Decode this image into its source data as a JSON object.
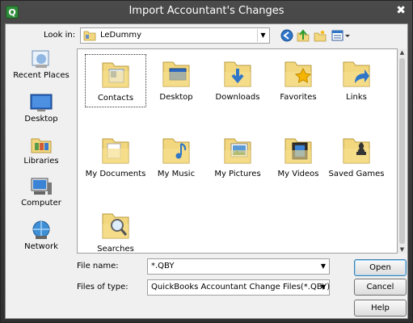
{
  "window": {
    "title": "Import Accountant's Changes",
    "app_icon_glyph": "Q",
    "close_glyph": "✖"
  },
  "lookin": {
    "label": "Look in:",
    "value": "LeDummy"
  },
  "toolbar": {
    "icons": [
      "back-icon",
      "up-folder-icon",
      "new-folder-icon",
      "views-menu-icon"
    ]
  },
  "places": [
    {
      "label": "Recent Places",
      "icon": "recent-places-icon"
    },
    {
      "label": "Desktop",
      "icon": "desktop-icon"
    },
    {
      "label": "Libraries",
      "icon": "libraries-icon"
    },
    {
      "label": "Computer",
      "icon": "computer-icon"
    },
    {
      "label": "Network",
      "icon": "network-icon"
    }
  ],
  "items": [
    {
      "label": "Contacts",
      "icon": "contacts-folder-icon",
      "selected": true
    },
    {
      "label": "Desktop",
      "icon": "desktop-folder-icon"
    },
    {
      "label": "Downloads",
      "icon": "downloads-folder-icon"
    },
    {
      "label": "Favorites",
      "icon": "favorites-folder-icon"
    },
    {
      "label": "Links",
      "icon": "links-folder-icon"
    },
    {
      "label": "My Documents",
      "icon": "documents-folder-icon"
    },
    {
      "label": "My Music",
      "icon": "music-folder-icon"
    },
    {
      "label": "My Pictures",
      "icon": "pictures-folder-icon"
    },
    {
      "label": "My Videos",
      "icon": "videos-folder-icon"
    },
    {
      "label": "Saved Games",
      "icon": "saved-games-folder-icon"
    },
    {
      "label": "Searches",
      "icon": "searches-folder-icon"
    }
  ],
  "filename": {
    "label": "File name:",
    "value": "*.QBY"
  },
  "filetype": {
    "label": "Files of type:",
    "value": "QuickBooks Accountant Change Files(*.QBY)"
  },
  "buttons": {
    "open": "Open",
    "cancel": "Cancel",
    "help": "Help"
  },
  "colors": {
    "title_bar": "#3a3a3a",
    "folder": "#f2d77e",
    "button_focus": "#3c7fb1"
  }
}
